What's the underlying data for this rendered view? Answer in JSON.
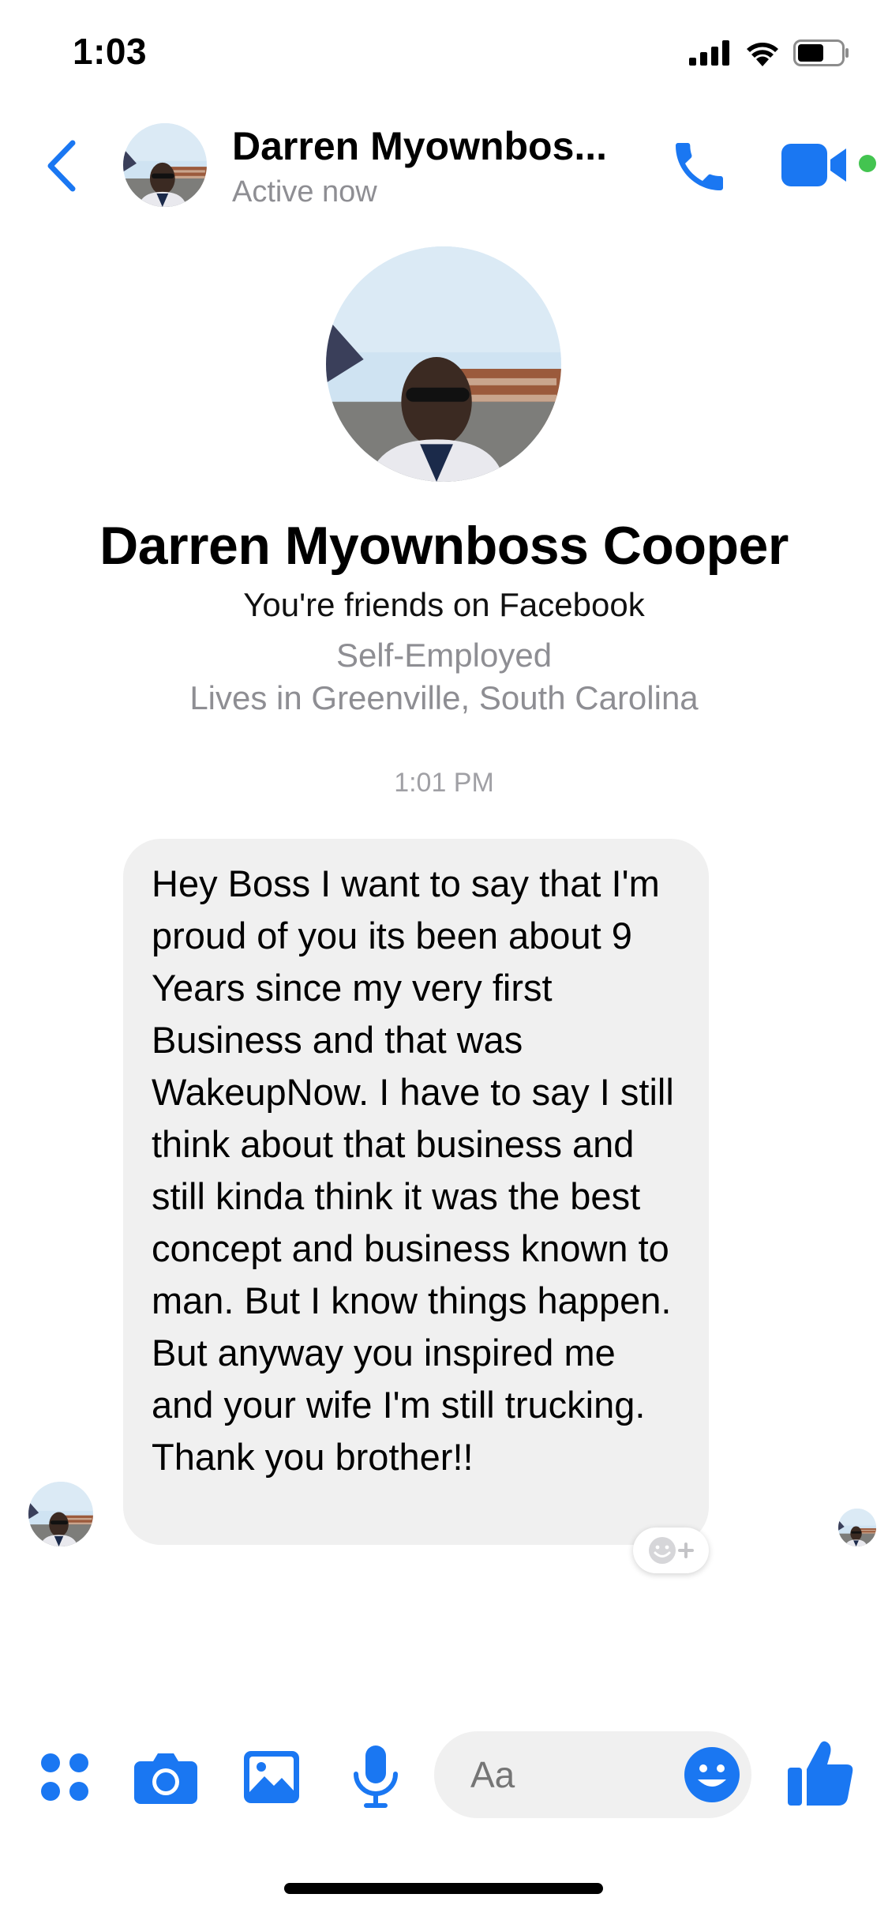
{
  "status_bar": {
    "time": "1:03",
    "icons": [
      "cellular-signal-icon",
      "wifi-icon",
      "battery-icon"
    ]
  },
  "header": {
    "back_icon": "chevron-left-icon",
    "contact_name": "Darren Myownbos...",
    "status": "Active now",
    "actions": [
      "phone-icon",
      "video-camera-icon"
    ],
    "online_indicator_color": "#43c450"
  },
  "profile": {
    "name": "Darren Myownboss Cooper",
    "relationship": "You're friends on Facebook",
    "work": "Self-Employed",
    "location": "Lives in Greenville, South Carolina"
  },
  "conversation": {
    "timestamp": "1:01 PM",
    "messages": [
      {
        "sender": "Darren Myownboss Cooper",
        "text": "Hey Boss I want to say that I'm proud of you its been about 9 Years since my very first Business and that was WakeupNow. I have to say I still think about that business and still kinda think it was the best concept and business known to man. But I know things happen. But anyway you inspired me and your wife I'm still trucking. Thank you brother!!"
      }
    ]
  },
  "composer": {
    "tools": [
      "more-apps-icon",
      "camera-icon",
      "photo-gallery-icon",
      "microphone-icon"
    ],
    "placeholder": "Aa",
    "emoji_icon": "smiley-icon",
    "send_icon": "thumbs-up-icon"
  },
  "colors": {
    "accent": "#1a77f2",
    "bubble_background": "#f0f0f0",
    "secondary_text": "#8e8e93"
  }
}
